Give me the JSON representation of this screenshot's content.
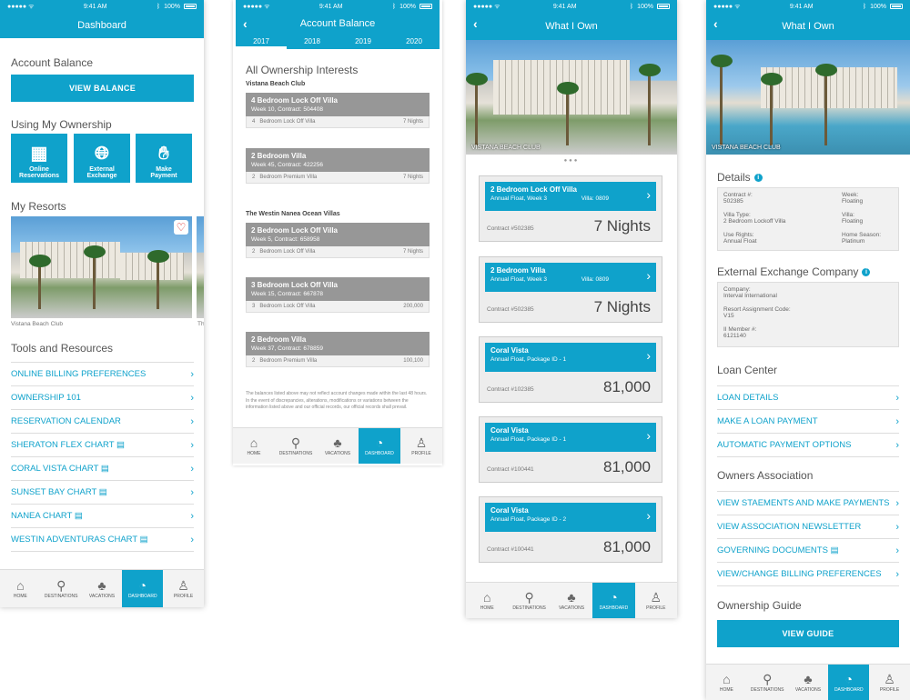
{
  "status": {
    "time": "9:41 AM",
    "battery": "100%"
  },
  "colors": {
    "accent": "#0fa2cb",
    "card_gray": "#979797"
  },
  "tabs": [
    {
      "label": "HOME",
      "icon": "home-icon"
    },
    {
      "label": "DESTINATIONS",
      "icon": "map-pin-icon"
    },
    {
      "label": "VACATIONS",
      "icon": "palm-tree-icon"
    },
    {
      "label": "DASHBOARD",
      "icon": "dashboard-icon"
    },
    {
      "label": "PROFILE",
      "icon": "profile-icon"
    }
  ],
  "screen1": {
    "title": "Dashboard",
    "account_balance": "Account Balance",
    "view_balance": "VIEW BALANCE",
    "using": "Using My Ownership",
    "tiles": [
      {
        "label1": "Online",
        "label2": "Reservations",
        "icon": "calendar-icon"
      },
      {
        "label1": "External",
        "label2": "Exchange",
        "icon": "globe-icon"
      },
      {
        "label1": "Make",
        "label2": "Payment",
        "icon": "payment-icon"
      }
    ],
    "my_resorts": "My Resorts",
    "resort_caption": "Vistana Beach Club",
    "resort_caption2": "Th",
    "tools": "Tools and Resources",
    "links": [
      {
        "label": "ONLINE BILLING PREFERENCES",
        "pdf": false
      },
      {
        "label": "OWNERSHIP 101",
        "pdf": false
      },
      {
        "label": "RESERVATION CALENDAR",
        "pdf": false
      },
      {
        "label": "SHERATON FLEX CHART",
        "pdf": true
      },
      {
        "label": "CORAL VISTA CHART",
        "pdf": true
      },
      {
        "label": "SUNSET BAY CHART",
        "pdf": true
      },
      {
        "label": "NANEA CHART",
        "pdf": true
      },
      {
        "label": "WESTIN ADVENTURAS CHART",
        "pdf": true
      }
    ]
  },
  "screen2": {
    "title": "Account Balance",
    "years": [
      "2017",
      "2018",
      "2019",
      "2020"
    ],
    "heading": "All Ownership Interests",
    "groups": [
      {
        "name": "Vistana Beach Club",
        "items": [
          {
            "title": "4 Bedroom Lock Off Villa",
            "sub": "Week 10, Contract: 504408",
            "num": "4",
            "type": "Bedroom Lock Off Villa",
            "right": "7 Nights"
          },
          {
            "title": "2 Bedroom Villa",
            "sub": "Week 45, Contract: 422256",
            "num": "2",
            "type": "Bedroom Premium Villa",
            "right": "7 Nights"
          }
        ]
      },
      {
        "name": "The Westin Nanea Ocean Villas",
        "items": [
          {
            "title": "2 Bedroom Lock Off Villa",
            "sub": "Week 5, Contract: 658958",
            "num": "2",
            "type": "Bedroom  Lock Off Villa",
            "right": "7 Nights"
          },
          {
            "title": "3 Bedroom Lock Off Villa",
            "sub": "Week 15, Contract: 667878",
            "num": "3",
            "type": "Bedroom Lock Off Villa",
            "right": "200,000"
          },
          {
            "title": "2 Bedroom Villa",
            "sub": "Week 37, Contract: 678859",
            "num": "2",
            "type": "Bedroom Premium Villa",
            "right": "100,100"
          }
        ]
      }
    ],
    "disclaimer": "The balances listed above may not reflect account changes made within the last 48 hours. In the event of discrepancies, alterations, modifications or variations between the information listed above and our official records, our official records shall prevail."
  },
  "screen3": {
    "title": "What I Own",
    "caption": "VISTANA BEACH CLUB",
    "cards": [
      {
        "title": "2 Bedroom Lock Off Villa",
        "sub": "Annual Float, Week 3",
        "villa": "Villa: 0809",
        "contract": "Contract #502385",
        "value": "7 Nights"
      },
      {
        "title": "2 Bedroom Villa",
        "sub": "Annual Float, Week 3",
        "villa": "Villa: 0809",
        "contract": "Contract #502385",
        "value": "7 Nights"
      },
      {
        "title": "Coral Vista",
        "sub": "Annual Float, Package ID - 1",
        "villa": "",
        "contract": "Contract #102385",
        "value": "81,000"
      },
      {
        "title": "Coral Vista",
        "sub": "Annual Float, Package ID - 1",
        "villa": "",
        "contract": "Contract #100441",
        "value": "81,000"
      },
      {
        "title": "Coral Vista",
        "sub": "Annual Float, Package ID - 2",
        "villa": "",
        "contract": "Contract #100441",
        "value": "81,000"
      }
    ]
  },
  "screen4": {
    "title": "What I Own",
    "caption": "VISTANA BEACH CLUB",
    "details": "Details",
    "detail_fields": [
      {
        "label": "Contract #:",
        "value": "502385",
        "label2": "Week:",
        "value2": "Floating"
      },
      {
        "label": "Villa Type:",
        "value": "2 Bedroom Lockoff Villa",
        "label2": "Villa:",
        "value2": "Floating"
      },
      {
        "label": "Use Rights:",
        "value": "Annual Float",
        "label2": "Home Season:",
        "value2": "Platinum"
      }
    ],
    "exchange": "External Exchange Company",
    "exchange_fields": [
      {
        "label": "Company:",
        "value": "Interval International"
      },
      {
        "label": "Resort Assignment Code:",
        "value": "V15"
      },
      {
        "label": "II Member #:",
        "value": "6121140"
      }
    ],
    "loan": "Loan Center",
    "loan_links": [
      "LOAN DETAILS",
      "MAKE A LOAN PAYMENT",
      "AUTOMATIC PAYMENT OPTIONS"
    ],
    "owners": "Owners Association",
    "owners_links": [
      {
        "label": "VIEW STAEMENTS AND MAKE PAYMENTS",
        "pdf": false
      },
      {
        "label": "VIEW ASSOCIATION NEWSLETTER",
        "pdf": false
      },
      {
        "label": "GOVERNING DOCUMENTS",
        "pdf": true
      },
      {
        "label": "VIEW/CHANGE BILLING PREFERENCES",
        "pdf": false
      }
    ],
    "guide": "Ownership Guide",
    "view_guide": "VIEW GUIDE"
  }
}
